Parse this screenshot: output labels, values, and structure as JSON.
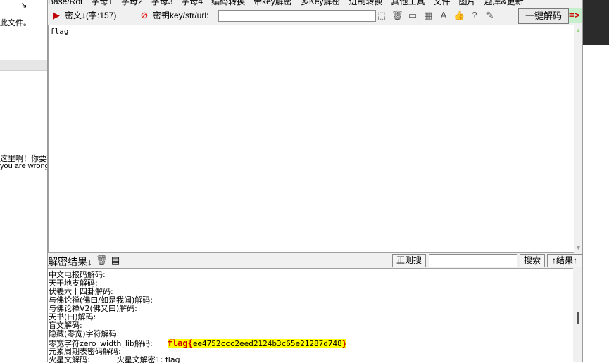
{
  "background_left": {
    "top_icon": "⇲",
    "text1": "此文件。",
    "text2": "这里啊！你要不要",
    "text3": "you are wrong"
  },
  "menu": [
    "Base/Rot",
    "字母1",
    "字母2",
    "字母3",
    "字母4",
    "编码转换",
    "带key解密",
    "多Key解密",
    "进制转换",
    "其他工具",
    "文件",
    "图片",
    "题库&更新"
  ],
  "toolbar": {
    "cipher_label": "密文↓(字:157)",
    "key_label": "密钥key/str/url:",
    "key_value": "",
    "decode_button": "一键解码",
    "arrow_label": "=>"
  },
  "editor": {
    "content": "flag"
  },
  "result_bar": {
    "label": "解密结果↓",
    "regex_button": "正则搜",
    "search_value": "",
    "search_button": "搜索",
    "result_up_button": "↑结果↑"
  },
  "output": {
    "lines": [
      "中文电报码解码:",
      "天干地支解码:",
      "伏羲六十四卦解码:",
      "与佛论禅(佛曰/如是我闻)解码:",
      "与佛论禅V2(佛又曰)解码:",
      "天书(曰)解码:",
      "盲文解码:",
      "隐藏(零宽)字符解码:"
    ],
    "zw_label": "零宽字符zero_width_lib解码:",
    "flag_prefix": "flag{",
    "flag_body": "ee4752ccc2eed2124b3c65e21287d748",
    "flag_suffix": "}",
    "element_line": "元素周期表密码解码:",
    "martian_label": "火星文解码:",
    "martian_value": "火星文解密1: flag"
  },
  "colors": {
    "window_bg": "#f0f0f0",
    "highlight": "#ffff00",
    "flag_red": "#cc0000",
    "accent_green": "#c6efce"
  }
}
